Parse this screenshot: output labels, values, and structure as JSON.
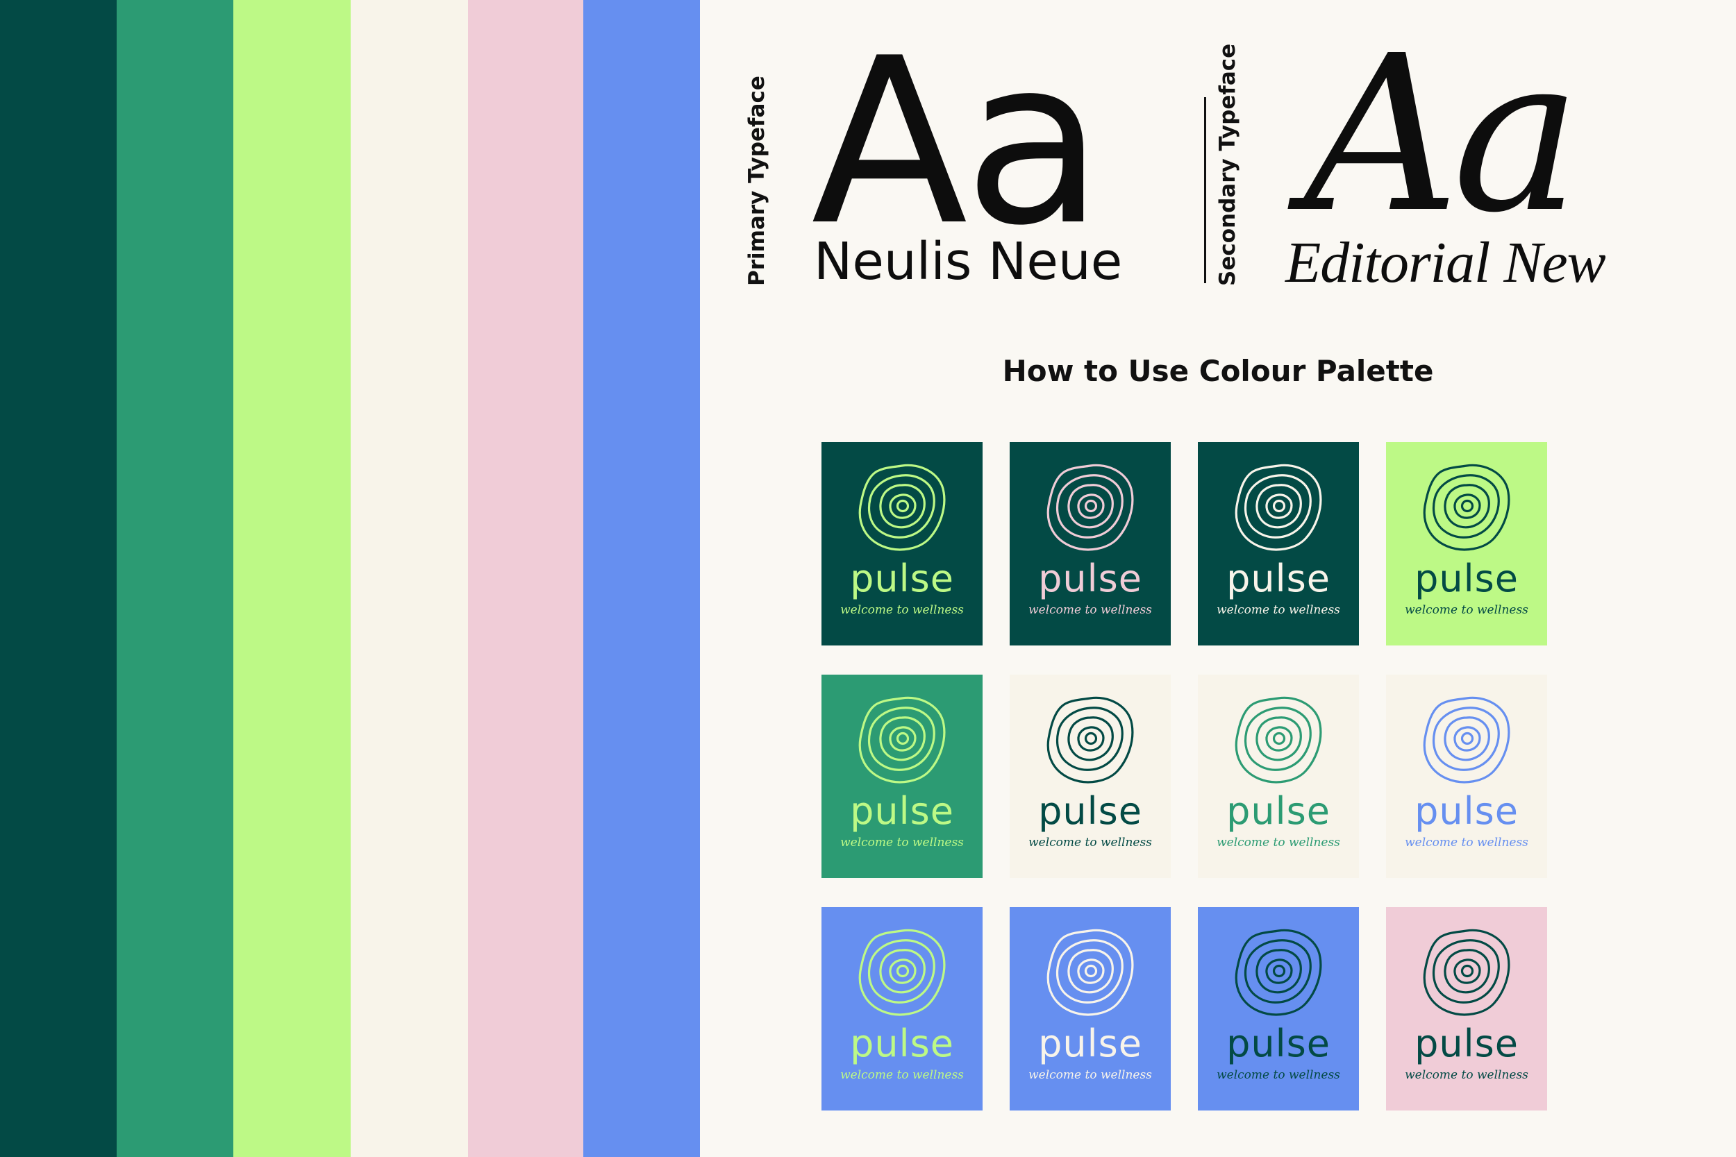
{
  "palette": {
    "stripes": [
      "#034a45",
      "#2c9b73",
      "#bdf986",
      "#f8f4ea",
      "#f0ccd7",
      "#668ff0"
    ]
  },
  "typography": {
    "primary_label": "Primary Typeface",
    "primary_sample": "Aa",
    "primary_name": "Neulis Neue",
    "secondary_label": "Secondary Typeface",
    "secondary_sample": "Aa",
    "secondary_name": "Editorial New"
  },
  "section": {
    "title": "How to Use Colour Palette"
  },
  "brand": {
    "name": "pulse",
    "tagline": "welcome to wellness"
  },
  "cards": [
    {
      "bg": "#034a45",
      "fg": "#bdf986"
    },
    {
      "bg": "#034a45",
      "fg": "#f0ccd7"
    },
    {
      "bg": "#034a45",
      "fg": "#f8f4ea"
    },
    {
      "bg": "#bdf986",
      "fg": "#034a45"
    },
    {
      "bg": "#2c9b73",
      "fg": "#bdf986"
    },
    {
      "bg": "#f8f4ea",
      "fg": "#034a45"
    },
    {
      "bg": "#f8f4ea",
      "fg": "#2c9b73"
    },
    {
      "bg": "#f8f4ea",
      "fg": "#668ff0"
    },
    {
      "bg": "#668ff0",
      "fg": "#bdf986"
    },
    {
      "bg": "#668ff0",
      "fg": "#f8f4ea"
    },
    {
      "bg": "#668ff0",
      "fg": "#034a45"
    },
    {
      "bg": "#f0ccd7",
      "fg": "#034a45"
    }
  ],
  "icons": {
    "logo": "concentric-rings-icon"
  }
}
